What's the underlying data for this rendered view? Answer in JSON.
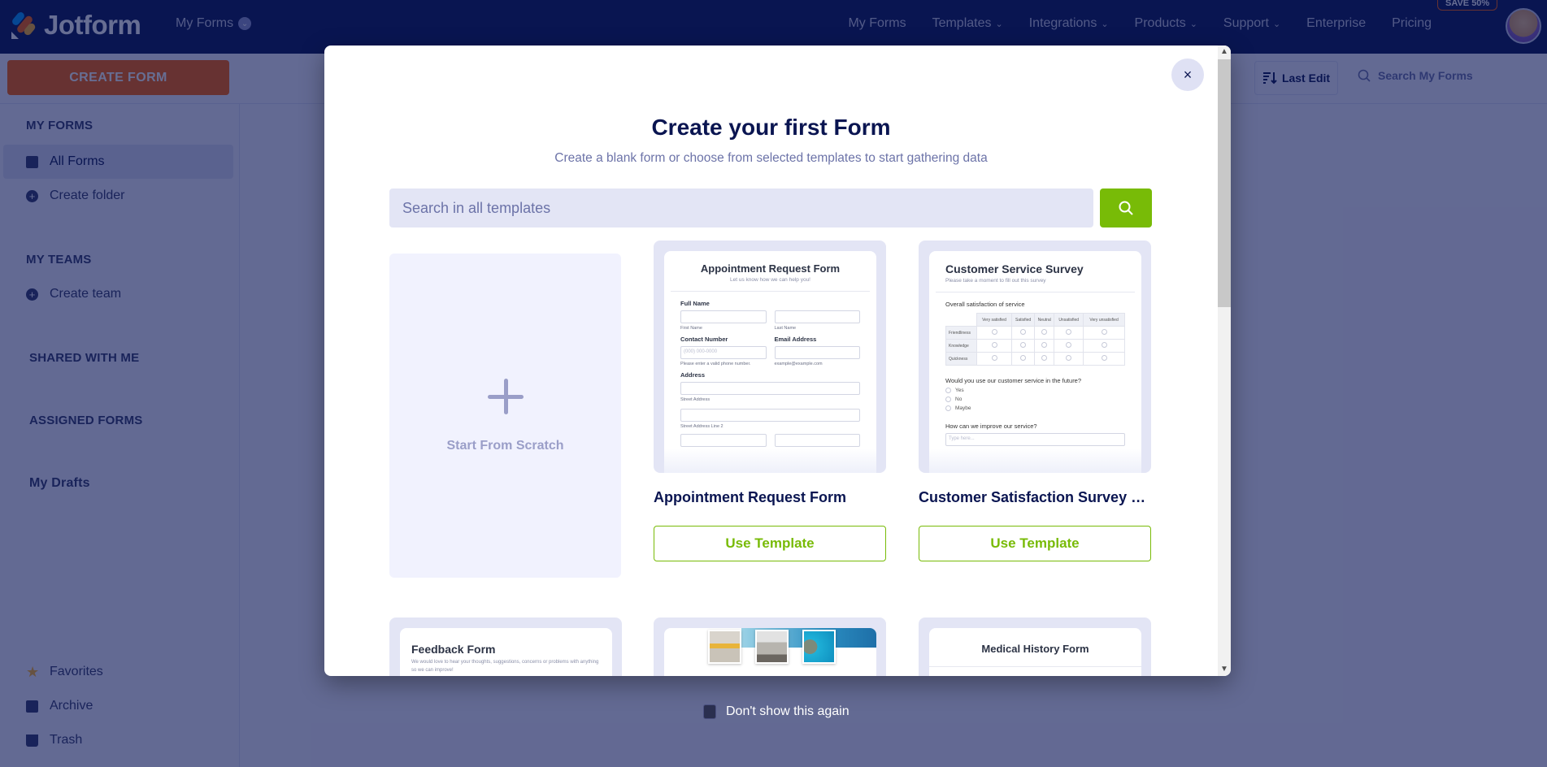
{
  "header": {
    "brand": "Jotform",
    "context_menu": "My Forms",
    "nav": [
      {
        "label": "My Forms",
        "has_caret": false
      },
      {
        "label": "Templates",
        "has_caret": true
      },
      {
        "label": "Integrations",
        "has_caret": true
      },
      {
        "label": "Products",
        "has_caret": true
      },
      {
        "label": "Support",
        "has_caret": true
      },
      {
        "label": "Enterprise",
        "has_caret": false
      },
      {
        "label": "Pricing",
        "has_caret": false
      }
    ],
    "promo_badge": "SAVE 50%",
    "avatar_icon": "user-avatar"
  },
  "toolbar": {
    "create_form_label": "CREATE FORM",
    "sort_label": "Last Edit",
    "search_placeholder": "Search My Forms"
  },
  "sidebar": {
    "my_forms_heading": "MY FORMS",
    "all_forms": "All Forms",
    "create_folder": "Create folder",
    "my_teams_heading": "MY TEAMS",
    "create_team": "Create team",
    "shared_heading": "SHARED WITH ME",
    "assigned_heading": "ASSIGNED FORMS",
    "my_drafts": "My Drafts",
    "favorites": "Favorites",
    "archive": "Archive",
    "trash": "Trash"
  },
  "modal": {
    "title": "Create your first Form",
    "subtitle": "Create a blank form or choose from selected templates to start gathering data",
    "search_placeholder": "Search in all templates",
    "close_icon": "×",
    "scratch_label": "Start From Scratch",
    "use_template_label": "Use Template",
    "templates": [
      {
        "name": "Appointment Request Form",
        "preview": {
          "title": "Appointment Request Form",
          "subtitle": "Let us know how we can help you!",
          "full_name": "Full Name",
          "first_name": "First Name",
          "last_name": "Last Name",
          "contact_number": "Contact Number",
          "phone_placeholder": "(000) 000-0000",
          "phone_hint": "Please enter a valid phone number.",
          "email": "Email Address",
          "email_hint": "example@example.com",
          "address": "Address",
          "street": "Street Address",
          "street2": "Street Address Line 2"
        }
      },
      {
        "name": "Customer Satisfaction Survey Fo...",
        "preview": {
          "title": "Customer Service Survey",
          "subtitle": "Please take a moment to fill out this survey",
          "matrix_label": "Overall satisfaction of service",
          "columns": [
            "Very satisfied",
            "Satisfied",
            "Neutral",
            "Unsatisfied",
            "Very unsatisfied"
          ],
          "rows": [
            "Friendliness",
            "Knowledge",
            "Quickness"
          ],
          "question": "Would you use our customer service in the future?",
          "options": [
            "Yes",
            "No",
            "Maybe"
          ],
          "improve": "How can we improve our service?",
          "improve_placeholder": "Type here..."
        }
      }
    ],
    "row2": [
      {
        "title": "Feedback Form",
        "subtitle": "We would love to hear your thoughts, suggestions, concerns or problems with anything so we can improve!"
      },
      {
        "title": "",
        "subtitle": ""
      },
      {
        "title": "Medical History Form",
        "subtitle": ""
      }
    ]
  },
  "dont_show": {
    "label": "Don't show this again",
    "checked": false
  }
}
